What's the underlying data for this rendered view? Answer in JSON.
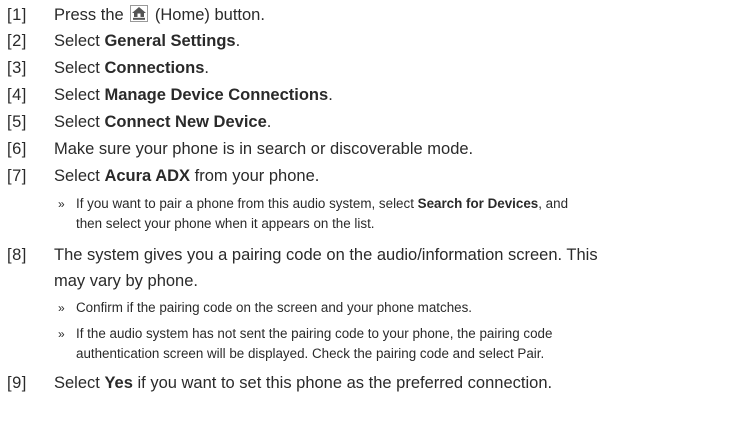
{
  "icons": {
    "home": "home-button-icon"
  },
  "steps": [
    {
      "num": "[1]",
      "pre": "Press the",
      "post": "(Home) button."
    },
    {
      "num": "[2]",
      "pre": "Select ",
      "bold": "General Settings",
      "post": "."
    },
    {
      "num": "[3]",
      "pre": "Select ",
      "bold": "Connections",
      "post": "."
    },
    {
      "num": "[4]",
      "pre": "Select ",
      "bold": "Manage Device Connections",
      "post": "."
    },
    {
      "num": "[5]",
      "pre": "Select ",
      "bold": "Connect New Device",
      "post": "."
    },
    {
      "num": "[6]",
      "text": "Make sure your phone is in search or discoverable mode."
    },
    {
      "num": "[7]",
      "pre": "Select ",
      "bold": "Acura ADX",
      "post": " from your phone."
    },
    {
      "num": "[8]",
      "line1": "The system gives you a pairing code on the audio/information screen. This",
      "line2": "may vary by phone."
    },
    {
      "num": "[9]",
      "pre": "Select ",
      "bold": "Yes",
      "post": " if you want to set this phone as the preferred connection."
    }
  ],
  "notes": {
    "marker": "»",
    "n7": {
      "pre": "If you want to pair a phone from this audio system, select ",
      "bold": "Search for Devices",
      "post": ", and",
      "line2": "then select your phone when it appears on the list."
    },
    "n8a": {
      "line1": "Confirm if the pairing code on the screen and your phone matches."
    },
    "n8b": {
      "line1": "If the audio system has not sent the pairing code to your phone, the pairing code",
      "line2": "authentication screen will be displayed. Check the pairing code and select Pair."
    }
  }
}
